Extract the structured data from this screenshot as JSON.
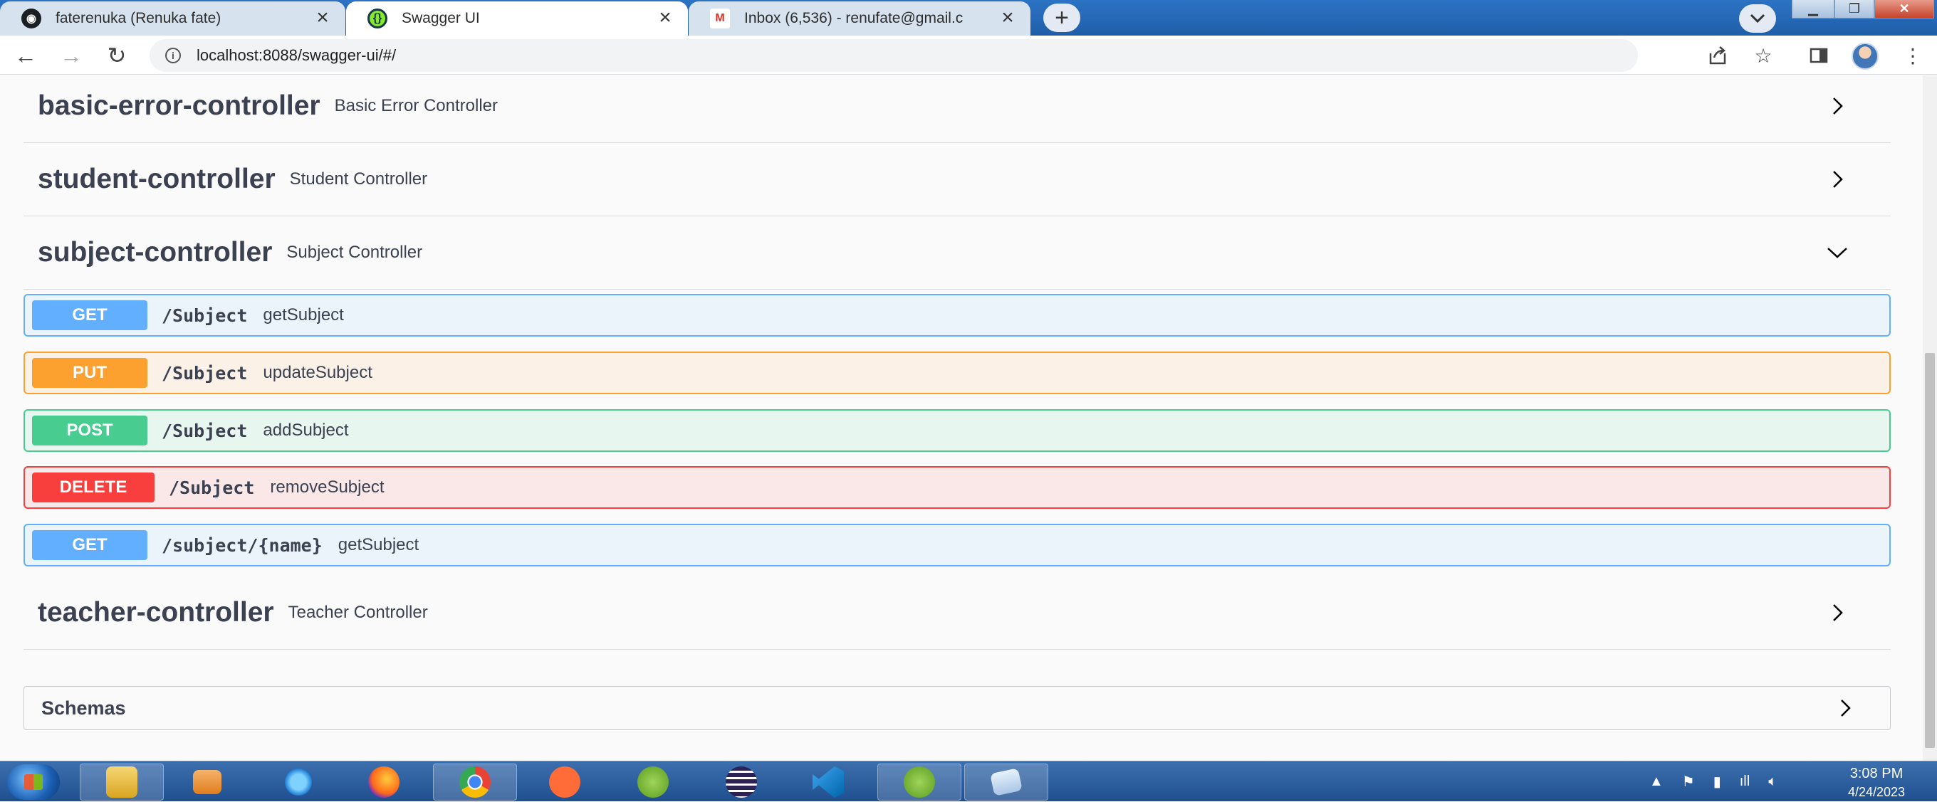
{
  "browser": {
    "tabs": [
      {
        "title": "faterenuka (Renuka fate)",
        "icon": "github-icon",
        "active": false
      },
      {
        "title": "Swagger UI",
        "icon": "swagger-icon",
        "active": true
      },
      {
        "title": "Inbox (6,536) - renufate@gmail.c",
        "icon": "gmail-icon",
        "active": false
      }
    ],
    "new_tab": "+",
    "url": "localhost:8088/swagger-ui/#/"
  },
  "swagger": {
    "sections": [
      {
        "name": "basic-error-controller",
        "description": "Basic Error Controller",
        "expanded": false
      },
      {
        "name": "student-controller",
        "description": "Student Controller",
        "expanded": false
      },
      {
        "name": "subject-controller",
        "description": "Subject Controller",
        "expanded": true
      },
      {
        "name": "teacher-controller",
        "description": "Teacher Controller",
        "expanded": false
      }
    ],
    "operations": [
      {
        "method": "GET",
        "path": "/Subject",
        "summary": "getSubject"
      },
      {
        "method": "PUT",
        "path": "/Subject",
        "summary": "updateSubject"
      },
      {
        "method": "POST",
        "path": "/Subject",
        "summary": "addSubject"
      },
      {
        "method": "DELETE",
        "path": "/Subject",
        "summary": "removeSubject"
      },
      {
        "method": "GET",
        "path": "/subject/{name}",
        "summary": "getSubject"
      }
    ],
    "schemas_label": "Schemas"
  },
  "taskbar": {
    "apps": [
      "file-explorer-icon",
      "media-player-icon",
      "internet-explorer-icon",
      "firefox-icon",
      "chrome-icon",
      "postman-icon",
      "spring-tools-icon",
      "eclipse-icon",
      "vscode-icon",
      "spring-tools-icon",
      "notepad-icon"
    ],
    "time": "3:08 PM",
    "date": "4/24/2023"
  }
}
